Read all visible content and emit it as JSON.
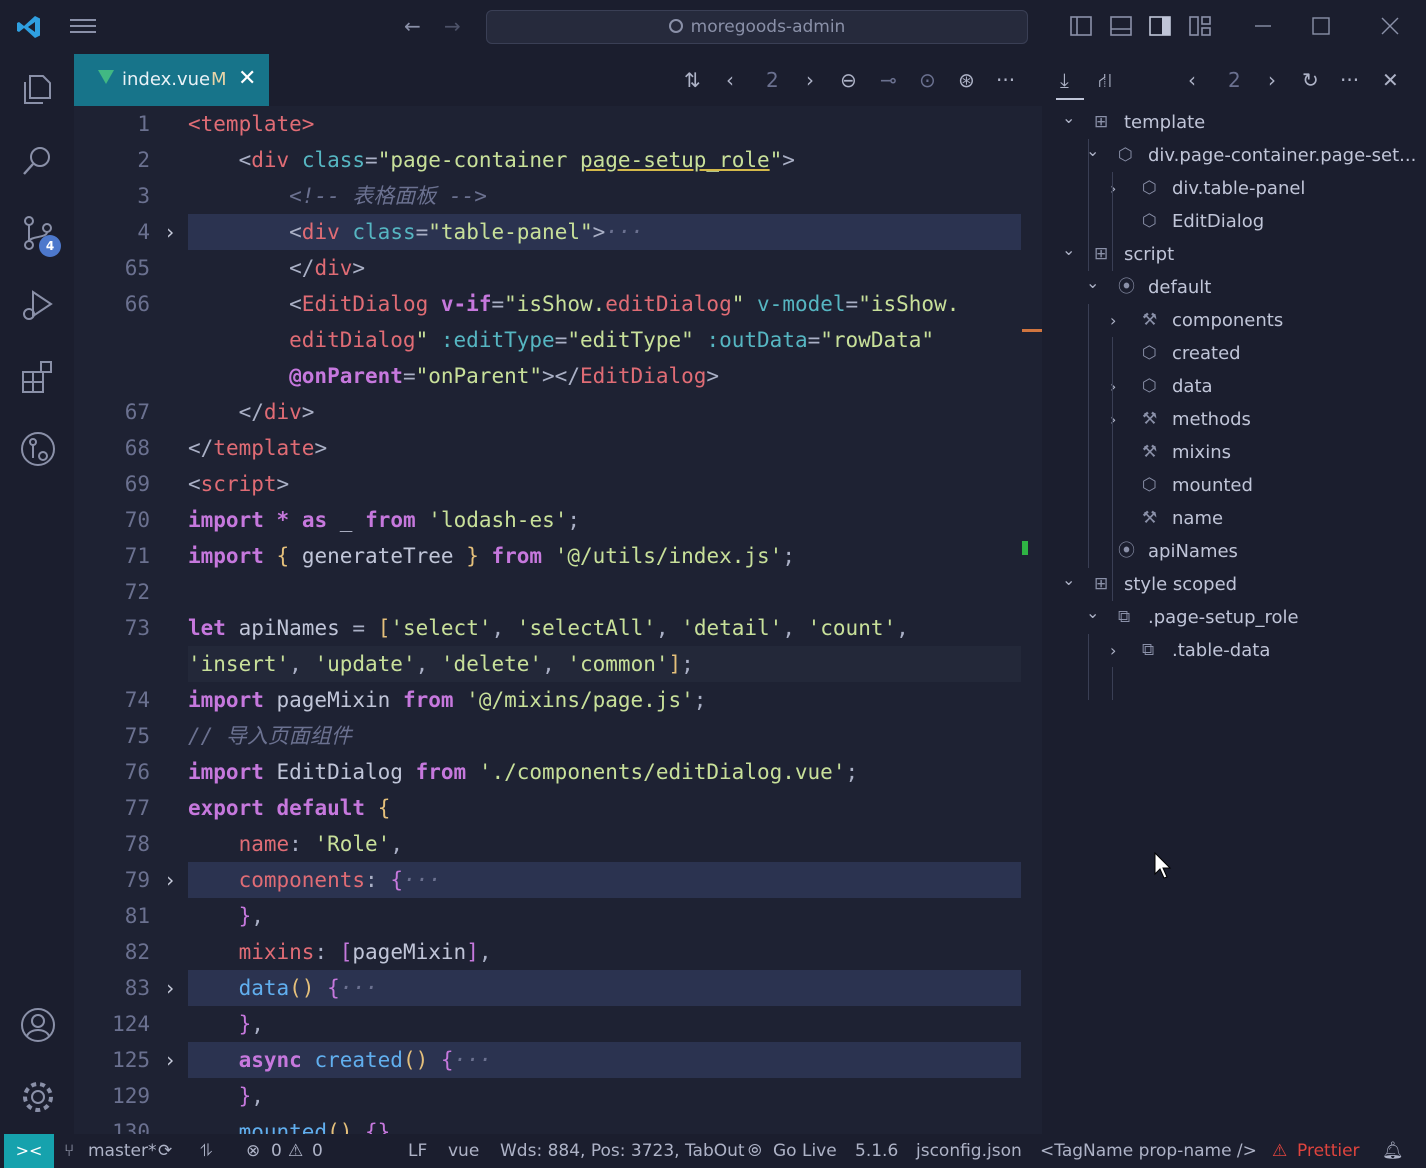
{
  "titlebar": {
    "search": "moregoods-admin"
  },
  "activity": {
    "scm_badge": "4"
  },
  "tab": {
    "name": "index.vue",
    "modified": "M",
    "close": "✕"
  },
  "editor_toolbar": {
    "conflict_count": "2"
  },
  "lines": [
    {
      "n": "1",
      "fold": "",
      "hl": "",
      "tokens": [
        [
          "tag",
          "<template>"
        ]
      ]
    },
    {
      "n": "2",
      "fold": "",
      "hl": "",
      "tokens": [
        [
          "pun",
          "    <"
        ],
        [
          "tag",
          "div"
        ],
        [
          "id",
          " "
        ],
        [
          "attr",
          "class"
        ],
        [
          "pun",
          "="
        ],
        [
          "str",
          "\"page-container "
        ],
        [
          "str ul",
          "page-setup_role"
        ],
        [
          "str",
          "\""
        ],
        [
          "pun",
          ">"
        ]
      ]
    },
    {
      "n": "3",
      "fold": "",
      "hl": "",
      "tokens": [
        [
          "cm",
          "        <!-- 表格面板 -->"
        ]
      ]
    },
    {
      "n": "4",
      "fold": "›",
      "hl": "hl",
      "tokens": [
        [
          "pun",
          "        <"
        ],
        [
          "tag",
          "div"
        ],
        [
          "id",
          " "
        ],
        [
          "attr",
          "class"
        ],
        [
          "pun",
          "="
        ],
        [
          "str",
          "\"table-panel\""
        ],
        [
          "pun",
          ">"
        ],
        [
          "cm",
          "···"
        ]
      ]
    },
    {
      "n": "65",
      "fold": "",
      "hl": "",
      "tokens": [
        [
          "pun",
          "        </"
        ],
        [
          "tag",
          "div"
        ],
        [
          "pun",
          ">"
        ]
      ]
    },
    {
      "n": "66",
      "fold": "",
      "hl": "",
      "tokens": [
        [
          "pun",
          "        <"
        ],
        [
          "tag",
          "EditDialog"
        ],
        [
          "id",
          " "
        ],
        [
          "kw",
          "v-if"
        ],
        [
          "pun",
          "="
        ],
        [
          "str",
          "\"isShow."
        ],
        [
          "tag",
          "editDialog"
        ],
        [
          "str",
          "\""
        ],
        [
          "id",
          " "
        ],
        [
          "attr",
          "v-model"
        ],
        [
          "pun",
          "="
        ],
        [
          "str",
          "\"isShow."
        ]
      ]
    },
    {
      "n": "",
      "fold": "",
      "hl": "",
      "tokens": [
        [
          "tag",
          "        editDialog"
        ],
        [
          "str",
          "\""
        ],
        [
          "id",
          " "
        ],
        [
          "attr",
          ":editType"
        ],
        [
          "pun",
          "="
        ],
        [
          "str",
          "\"editType\""
        ],
        [
          "id",
          " "
        ],
        [
          "attr",
          ":outData"
        ],
        [
          "pun",
          "="
        ],
        [
          "str",
          "\"rowData\""
        ]
      ]
    },
    {
      "n": "",
      "fold": "",
      "hl": "",
      "tokens": [
        [
          "kw",
          "        @onParent"
        ],
        [
          "pun",
          "="
        ],
        [
          "str",
          "\"onParent\""
        ],
        [
          "pun",
          "></"
        ],
        [
          "tag",
          "EditDialog"
        ],
        [
          "pun",
          ">"
        ]
      ]
    },
    {
      "n": "67",
      "fold": "",
      "hl": "",
      "tokens": [
        [
          "pun",
          "    </"
        ],
        [
          "tag",
          "div"
        ],
        [
          "pun",
          ">"
        ]
      ]
    },
    {
      "n": "68",
      "fold": "",
      "hl": "",
      "tokens": [
        [
          "pun",
          "</"
        ],
        [
          "tag",
          "template"
        ],
        [
          "pun",
          ">"
        ]
      ]
    },
    {
      "n": "69",
      "fold": "",
      "hl": "",
      "tokens": [
        [
          "pun",
          "<"
        ],
        [
          "tag",
          "script"
        ],
        [
          "pun",
          ">"
        ]
      ]
    },
    {
      "n": "70",
      "fold": "",
      "hl": "",
      "tokens": [
        [
          "kw",
          "import"
        ],
        [
          "id",
          " "
        ],
        [
          "kw",
          "*"
        ],
        [
          "id",
          " "
        ],
        [
          "kw",
          "as"
        ],
        [
          "id",
          " _ "
        ],
        [
          "kw",
          "from"
        ],
        [
          "id",
          " "
        ],
        [
          "str",
          "'lodash-es'"
        ],
        [
          "pun",
          ";"
        ]
      ]
    },
    {
      "n": "71",
      "fold": "",
      "hl": "",
      "tokens": [
        [
          "kw",
          "import"
        ],
        [
          "id",
          " "
        ],
        [
          "br",
          "{"
        ],
        [
          "id",
          " generateTree "
        ],
        [
          "br",
          "}"
        ],
        [
          "id",
          " "
        ],
        [
          "kw",
          "from"
        ],
        [
          "id",
          " "
        ],
        [
          "str",
          "'@/utils/index.js'"
        ],
        [
          "pun",
          ";"
        ]
      ]
    },
    {
      "n": "72",
      "fold": "",
      "hl": "",
      "tokens": []
    },
    {
      "n": "73",
      "fold": "",
      "hl": "",
      "tokens": [
        [
          "kw",
          "let"
        ],
        [
          "id",
          " apiNames "
        ],
        [
          "pun",
          "="
        ],
        [
          "id",
          " "
        ],
        [
          "br",
          "["
        ],
        [
          "str",
          "'select'"
        ],
        [
          "pun",
          ", "
        ],
        [
          "str",
          "'selectAll'"
        ],
        [
          "pun",
          ", "
        ],
        [
          "str",
          "'detail'"
        ],
        [
          "pun",
          ", "
        ],
        [
          "str",
          "'count'"
        ],
        [
          "pun",
          ","
        ]
      ]
    },
    {
      "n": "",
      "fold": "",
      "hl": "hl2",
      "tokens": [
        [
          "str",
          "'insert'"
        ],
        [
          "pun",
          ", "
        ],
        [
          "str",
          "'update'"
        ],
        [
          "pun",
          ", "
        ],
        [
          "str",
          "'delete'"
        ],
        [
          "pun",
          ", "
        ],
        [
          "str",
          "'common'"
        ],
        [
          "br",
          "]"
        ],
        [
          "pun",
          ";"
        ]
      ]
    },
    {
      "n": "74",
      "fold": "",
      "hl": "",
      "tokens": [
        [
          "kw",
          "import"
        ],
        [
          "id",
          " pageMixin "
        ],
        [
          "kw",
          "from"
        ],
        [
          "id",
          " "
        ],
        [
          "str",
          "'@/mixins/page.js'"
        ],
        [
          "pun",
          ";"
        ]
      ]
    },
    {
      "n": "75",
      "fold": "",
      "hl": "",
      "tokens": [
        [
          "cm",
          "// 导入页面组件"
        ]
      ]
    },
    {
      "n": "76",
      "fold": "",
      "hl": "",
      "tokens": [
        [
          "kw",
          "import"
        ],
        [
          "id",
          " EditDialog "
        ],
        [
          "kw",
          "from"
        ],
        [
          "id",
          " "
        ],
        [
          "str",
          "'./components/editDialog.vue'"
        ],
        [
          "pun",
          ";"
        ]
      ]
    },
    {
      "n": "77",
      "fold": "",
      "hl": "",
      "tokens": [
        [
          "kw",
          "export"
        ],
        [
          "id",
          " "
        ],
        [
          "kw",
          "default"
        ],
        [
          "id",
          " "
        ],
        [
          "br",
          "{"
        ]
      ]
    },
    {
      "n": "78",
      "fold": "",
      "hl": "",
      "tokens": [
        [
          "prop",
          "    name"
        ],
        [
          "pun",
          ": "
        ],
        [
          "str",
          "'Role'"
        ],
        [
          "pun",
          ","
        ]
      ]
    },
    {
      "n": "79",
      "fold": "›",
      "hl": "hl",
      "tokens": [
        [
          "prop",
          "    components"
        ],
        [
          "pun",
          ": "
        ],
        [
          "br2",
          "{"
        ],
        [
          "cm",
          "···"
        ]
      ]
    },
    {
      "n": "81",
      "fold": "",
      "hl": "",
      "tokens": [
        [
          "br2",
          "    }"
        ],
        [
          "pun",
          ","
        ]
      ]
    },
    {
      "n": "82",
      "fold": "",
      "hl": "",
      "tokens": [
        [
          "prop",
          "    mixins"
        ],
        [
          "pun",
          ": "
        ],
        [
          "br2",
          "["
        ],
        [
          "id",
          "pageMixin"
        ],
        [
          "br2",
          "]"
        ],
        [
          "pun",
          ","
        ]
      ]
    },
    {
      "n": "83",
      "fold": "›",
      "hl": "hl",
      "tokens": [
        [
          "fn",
          "    data"
        ],
        [
          "br",
          "()"
        ],
        [
          "id",
          " "
        ],
        [
          "br2",
          "{"
        ],
        [
          "cm",
          "···"
        ]
      ]
    },
    {
      "n": "124",
      "fold": "",
      "hl": "",
      "tokens": [
        [
          "br2",
          "    }"
        ],
        [
          "pun",
          ","
        ]
      ]
    },
    {
      "n": "125",
      "fold": "›",
      "hl": "hl",
      "tokens": [
        [
          "kw",
          "    async"
        ],
        [
          "id",
          " "
        ],
        [
          "fn",
          "created"
        ],
        [
          "br",
          "()"
        ],
        [
          "id",
          " "
        ],
        [
          "br2",
          "{"
        ],
        [
          "cm",
          "···"
        ]
      ]
    },
    {
      "n": "129",
      "fold": "",
      "hl": "",
      "tokens": [
        [
          "br2",
          "    }"
        ],
        [
          "pun",
          ","
        ]
      ]
    },
    {
      "n": "130",
      "fold": "",
      "hl": "",
      "tokens": [
        [
          "fn",
          "    mounted"
        ],
        [
          "br",
          "()"
        ],
        [
          "id",
          " "
        ],
        [
          "br2",
          "{}"
        ]
      ]
    }
  ],
  "outline_toolbar": {
    "count": "2"
  },
  "outline": [
    {
      "label": "template",
      "depth": 0,
      "tw": "⌄",
      "icon": "⊞",
      "name": "tree-template"
    },
    {
      "label": "div.page-container.page-set...",
      "depth": 1,
      "tw": "⌄",
      "icon": "⬡",
      "name": "tree-div-page-container"
    },
    {
      "label": "div.table-panel",
      "depth": 2,
      "tw": "›",
      "icon": "⬡",
      "name": "tree-div-table-panel"
    },
    {
      "label": "EditDialog",
      "depth": 2,
      "tw": "",
      "icon": "⬡",
      "name": "tree-editdialog"
    },
    {
      "label": "script",
      "depth": 0,
      "tw": "⌄",
      "icon": "⊞",
      "name": "tree-script"
    },
    {
      "label": "default",
      "depth": 1,
      "tw": "⌄",
      "icon": "⦿",
      "name": "tree-default"
    },
    {
      "label": "components",
      "depth": 2,
      "tw": "›",
      "icon": "⚒",
      "name": "tree-components"
    },
    {
      "label": "created",
      "depth": 2,
      "tw": "",
      "icon": "⬡",
      "name": "tree-created"
    },
    {
      "label": "data",
      "depth": 2,
      "tw": "›",
      "icon": "⬡",
      "name": "tree-data"
    },
    {
      "label": "methods",
      "depth": 2,
      "tw": "›",
      "icon": "⚒",
      "name": "tree-methods"
    },
    {
      "label": "mixins",
      "depth": 2,
      "tw": "",
      "icon": "⚒",
      "name": "tree-mixins"
    },
    {
      "label": "mounted",
      "depth": 2,
      "tw": "",
      "icon": "⬡",
      "name": "tree-mounted"
    },
    {
      "label": "name",
      "depth": 2,
      "tw": "",
      "icon": "⚒",
      "name": "tree-name"
    },
    {
      "label": "apiNames",
      "depth": 1,
      "tw": "",
      "icon": "⦿",
      "name": "tree-apinames"
    },
    {
      "label": "style scoped",
      "depth": 0,
      "tw": "⌄",
      "icon": "⊞",
      "name": "tree-style-scoped"
    },
    {
      "label": ".page-setup_role",
      "depth": 1,
      "tw": "⌄",
      "icon": "⧉",
      "name": "tree-page-setup-role"
    },
    {
      "label": ".table-data",
      "depth": 2,
      "tw": "›",
      "icon": "⧉",
      "name": "tree-table-data"
    }
  ],
  "status": {
    "branch": "master*",
    "errors": "0",
    "warnings": "0",
    "eol": "LF",
    "language": "vue",
    "words": "Wds: 884, Pos: 3723, TabOut",
    "golive": "Go Live",
    "version": "5.1.6",
    "config": "jsconfig.json",
    "tagname": "<TagName prop-name />",
    "prettier": "Prettier"
  },
  "colors": {
    "accent": "#17748a",
    "remote": "#16a2ad",
    "badge": "#4d78cc",
    "prettier": "#e0443e"
  }
}
